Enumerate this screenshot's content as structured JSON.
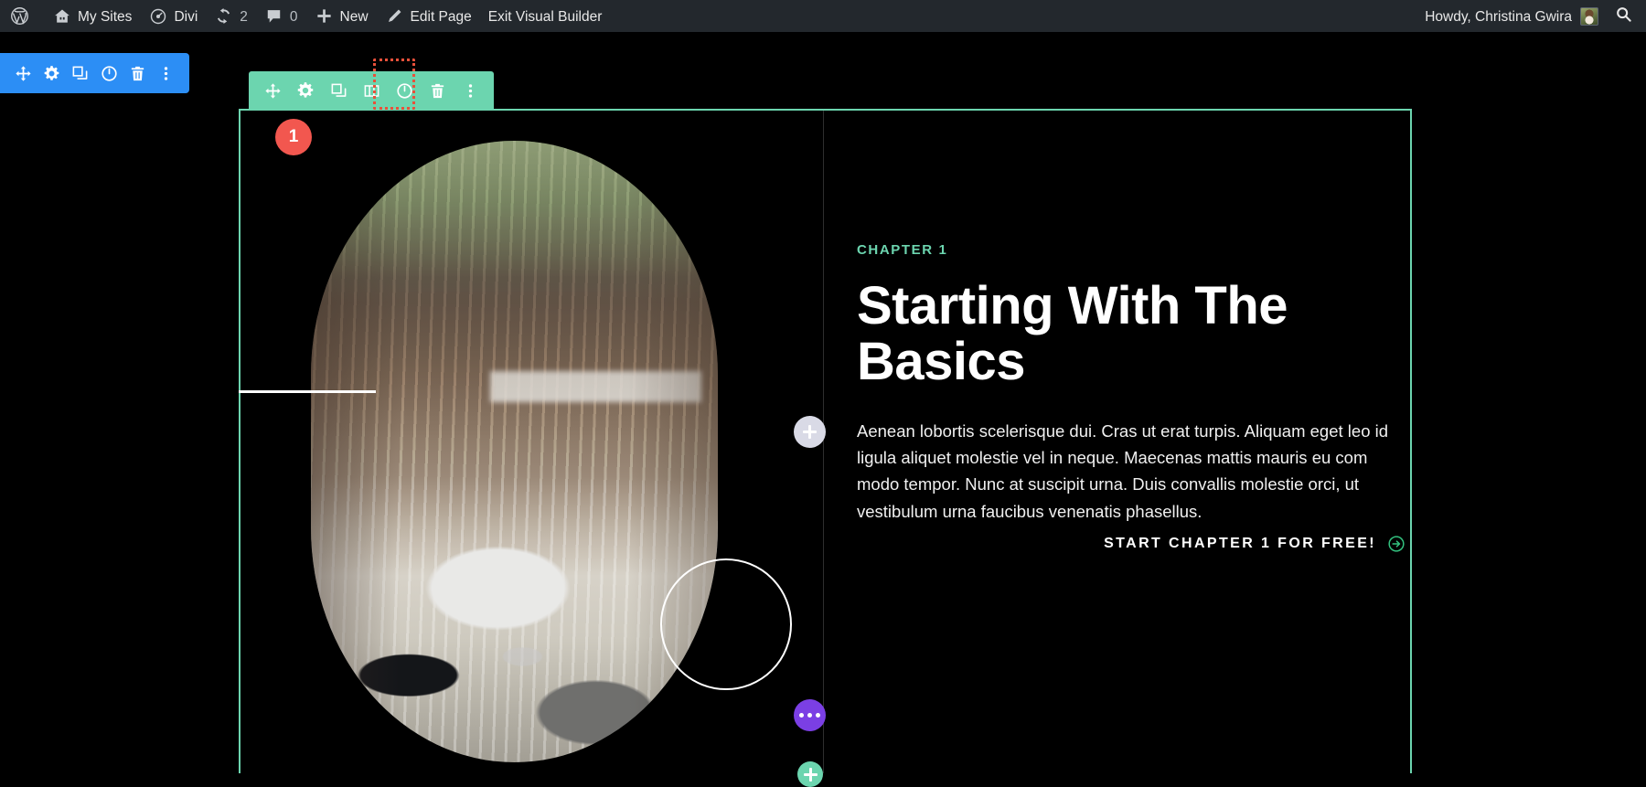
{
  "admin_bar": {
    "left_items": [
      {
        "icon": "wordpress-icon",
        "label": ""
      },
      {
        "icon": "sites-icon",
        "label": "My Sites"
      },
      {
        "icon": "divi-icon",
        "label": "Divi"
      },
      {
        "icon": "updates-icon",
        "label": "2"
      },
      {
        "icon": "comments-icon",
        "label": "0"
      },
      {
        "icon": "plus-icon",
        "label": "New"
      },
      {
        "icon": "pencil-icon",
        "label": "Edit Page"
      },
      {
        "icon": "",
        "label": "Exit Visual Builder"
      }
    ],
    "howdy": "Howdy, Christina Gwira",
    "avatar_name": "avatar",
    "search_icon": "search-icon"
  },
  "page_settings_bar": {
    "buttons": [
      {
        "name": "move-page-icon",
        "title": "Move"
      },
      {
        "name": "gear-icon",
        "title": "Settings"
      },
      {
        "name": "duplicate-icon",
        "title": "Duplicate"
      },
      {
        "name": "power-icon",
        "title": "Disable"
      },
      {
        "name": "trash-icon",
        "title": "Delete"
      },
      {
        "name": "more-vertical-icon",
        "title": "More"
      }
    ]
  },
  "section_toolbar": {
    "buttons": [
      {
        "name": "move-section-icon",
        "title": "Move Section"
      },
      {
        "name": "gear-icon",
        "title": "Section Settings"
      },
      {
        "name": "duplicate-icon",
        "title": "Duplicate Section"
      },
      {
        "name": "columns-icon",
        "title": "Column Structure"
      },
      {
        "name": "power-icon",
        "title": "Disable Section"
      },
      {
        "name": "trash-icon",
        "title": "Delete Section"
      },
      {
        "name": "more-vertical-icon",
        "title": "More Options"
      }
    ],
    "highlighted_button": "gear-icon"
  },
  "annotations": {
    "step_1": "1"
  },
  "content": {
    "eyebrow": "CHAPTER 1",
    "headline": "Starting With The Basics",
    "body": "Aenean lobortis scelerisque dui. Cras ut erat turpis. Aliquam eget leo id ligula aliquet molestie vel in neque. Maecenas mattis mauris eu com modo tempor. Nunc at suscipit urna. Duis convallis molestie orci, ut vestibulum urna faucibus venenatis phasellus.",
    "cta_label": "START CHAPTER 1 FOR FREE!",
    "cta_icon": "arrow-circle-right-icon",
    "image_alt": "desk-photo-oval"
  },
  "floating_controls": {
    "add_module": {
      "name": "add-module-button",
      "icon": "plus-icon"
    },
    "row_settings": {
      "name": "row-settings-button",
      "icon": "ellipsis-icon"
    },
    "section_add": {
      "name": "add-section-button",
      "icon": "plus-icon"
    }
  },
  "colors": {
    "admin_bar_bg": "#23282d",
    "page_bar_blue": "#2c8ef5",
    "section_teal": "#6cd5af",
    "badge_red": "#f2574f",
    "highlight_dashed": "#e8503a",
    "row_purple": "#7b3fe4",
    "module_gray": "#d9dae6",
    "eyebrow_green": "#6cd5af",
    "cta_green": "#33c27f",
    "canvas_bg": "#000000"
  }
}
